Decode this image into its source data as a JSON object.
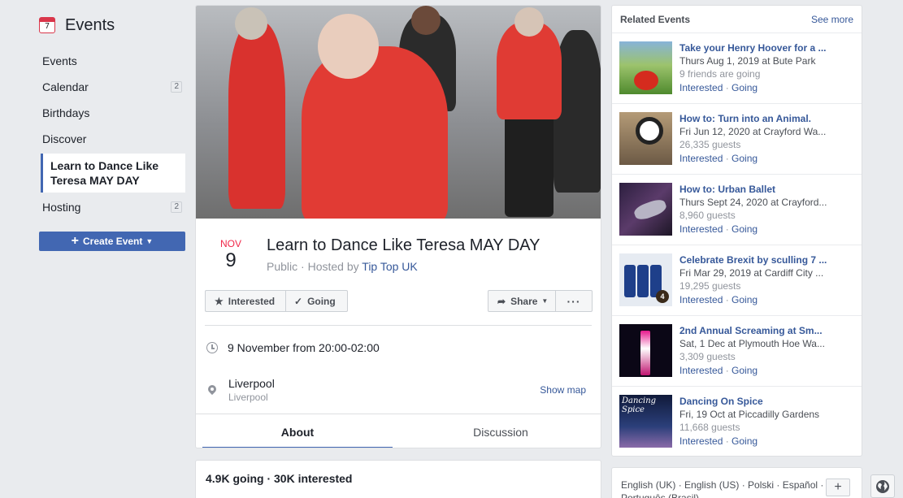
{
  "sidebar": {
    "title": "Events",
    "calendar_icon_day": "7",
    "items": [
      {
        "label": "Events",
        "badge": ""
      },
      {
        "label": "Calendar",
        "badge": "2"
      },
      {
        "label": "Birthdays",
        "badge": ""
      },
      {
        "label": "Discover",
        "badge": ""
      }
    ],
    "active_item": "Learn to Dance Like Teresa MAY DAY",
    "hosting": {
      "label": "Hosting",
      "badge": "2"
    },
    "create_button": "Create Event"
  },
  "event": {
    "month": "NOV",
    "day": "9",
    "title": "Learn to Dance Like Teresa MAY DAY",
    "privacy": "Public",
    "hosted_by_prefix": "Hosted by",
    "host": "Tip Top UK",
    "buttons": {
      "interested": "Interested",
      "going": "Going",
      "share": "Share",
      "more": "···"
    },
    "time": "9 November from 20:00-02:00",
    "location_name": "Liverpool",
    "location_sub": "Liverpool",
    "show_map": "Show map",
    "tabs": [
      "About",
      "Discussion"
    ],
    "stats": "4.9K going · 30K interested"
  },
  "related": {
    "title": "Related Events",
    "see_more": "See more",
    "interested_label": "Interested",
    "going_label": "Going",
    "items": [
      {
        "name": "Take your Henry Hoover for a ...",
        "date": "Thurs Aug 1, 2019 at Bute Park",
        "guests": "9 friends are going"
      },
      {
        "name": "How to: Turn into an Animal.",
        "date": "Fri Jun 12, 2020 at Crayford Wa...",
        "guests": "26,335 guests"
      },
      {
        "name": "How to: Urban Ballet",
        "date": "Thurs Sept 24, 2020 at Crayford...",
        "guests": "8,960 guests"
      },
      {
        "name": "Celebrate Brexit by sculling 7 ...",
        "date": "Fri Mar 29, 2019 at Cardiff City ...",
        "guests": "19,295 guests"
      },
      {
        "name": "2nd Annual Screaming at Sm...",
        "date": "Sat, 1 Dec at Plymouth Hoe Wa...",
        "guests": "3,309 guests"
      },
      {
        "name": "Dancing On Spice",
        "date": "Fri, 19 Oct at Piccadilly Gardens",
        "guests": "11,668 guests"
      }
    ],
    "thumb_texts": {
      "can_badge": "4",
      "spice_line1": "Dancing",
      "spice_line2": "Spice"
    }
  },
  "footer": {
    "languages": "English (UK) · English (US) · Polski · Español · Português (Brasil)",
    "add_button": "+"
  },
  "colors": {
    "accent": "#4267b2",
    "link": "#365899",
    "date_red": "#f02849"
  }
}
